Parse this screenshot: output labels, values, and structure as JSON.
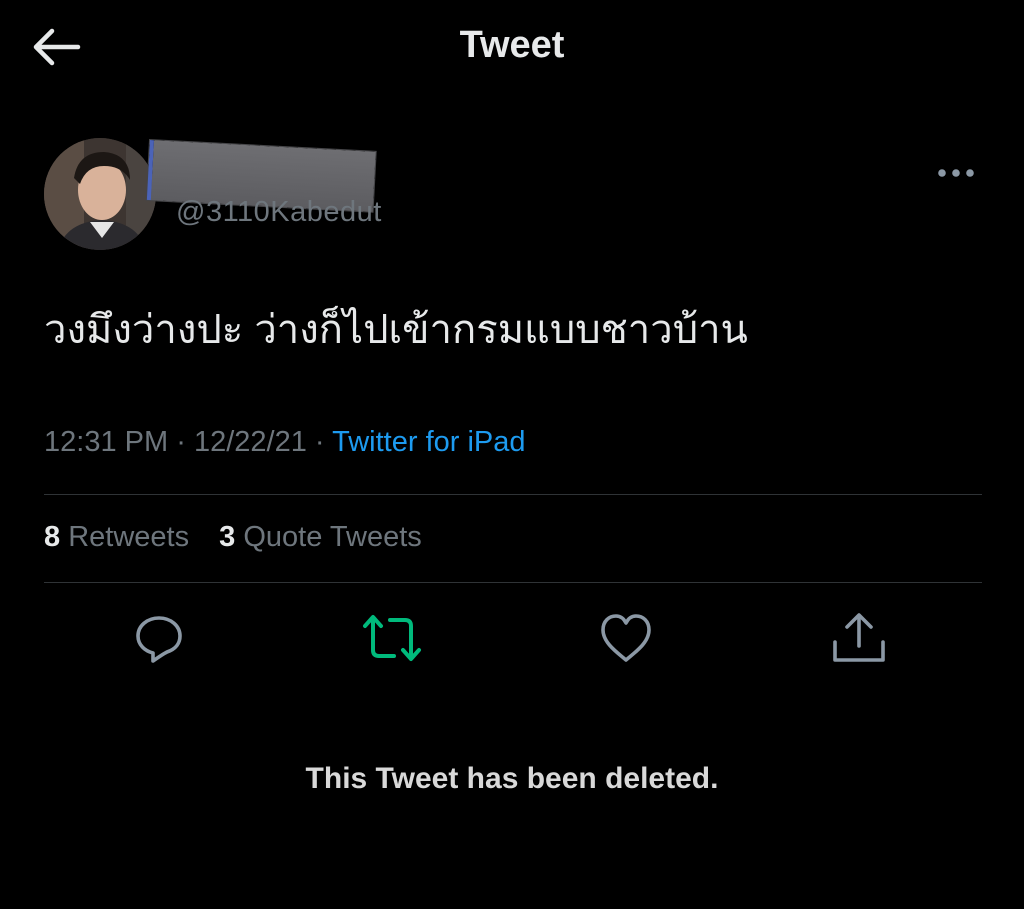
{
  "header": {
    "title": "Tweet"
  },
  "tweet": {
    "handle": "@3110Kabedut",
    "text": "วงมึงว่างปะ ว่างก็ไปเข้ากรมแบบชาวบ้าน",
    "time": "12:31 PM",
    "date": "12/22/21",
    "separator": "·",
    "source": "Twitter for iPad"
  },
  "stats": {
    "retweets_count": "8",
    "retweets_label": "Retweets",
    "quotes_count": "3",
    "quotes_label": "Quote Tweets"
  },
  "actions": {
    "icons": [
      "reply-icon",
      "retweet-icon",
      "like-icon",
      "share-icon"
    ],
    "retweet_color": "#00ba7c",
    "icon_color": "#8b98a5"
  },
  "notice": {
    "text": "This Tweet has been deleted."
  },
  "colors": {
    "background": "#000000",
    "link": "#1d9bf0",
    "muted": "#6e767d",
    "text": "#e7e9ea",
    "divider": "#2f3336"
  }
}
